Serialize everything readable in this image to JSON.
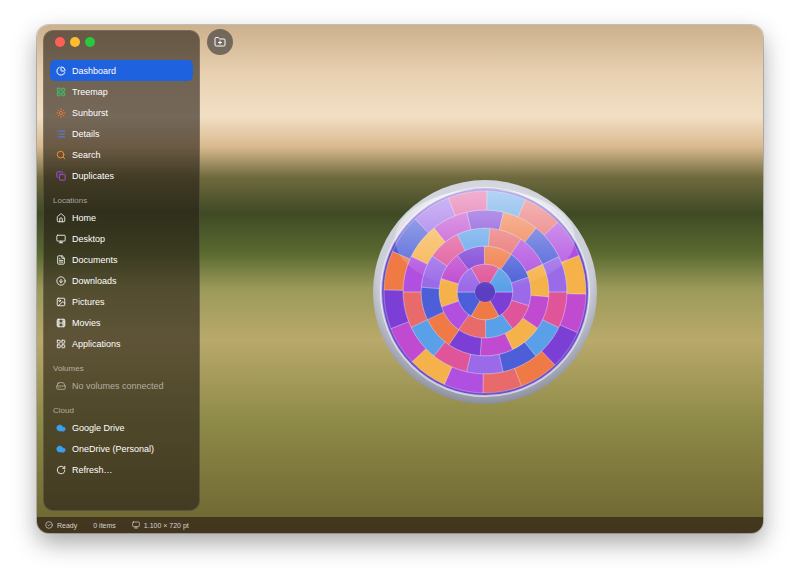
{
  "window": {
    "title": ""
  },
  "sidebar": {
    "nav": [
      {
        "label": "Dashboard",
        "selected": true,
        "color": "#e0409a"
      },
      {
        "label": "Treemap",
        "selected": false,
        "color": "#3cc46a"
      },
      {
        "label": "Sunburst",
        "selected": false,
        "color": "#f07a2a"
      },
      {
        "label": "Details",
        "selected": false,
        "color": "#5b7ff0"
      },
      {
        "label": "Search",
        "selected": false,
        "color": "#f0902a"
      },
      {
        "label": "Duplicates",
        "selected": false,
        "color": "#a04ee0"
      }
    ],
    "sections": [
      {
        "title": "Locations",
        "items": [
          {
            "label": "Home",
            "disabled": false,
            "kind": "place"
          },
          {
            "label": "Desktop",
            "disabled": false,
            "kind": "place"
          },
          {
            "label": "Documents",
            "disabled": false,
            "kind": "place"
          },
          {
            "label": "Downloads",
            "disabled": false,
            "kind": "place"
          },
          {
            "label": "Pictures",
            "disabled": false,
            "kind": "place"
          },
          {
            "label": "Movies",
            "disabled": false,
            "kind": "place"
          },
          {
            "label": "Applications",
            "disabled": false,
            "kind": "place"
          }
        ]
      },
      {
        "title": "Volumes",
        "items": [
          {
            "label": "No volumes connected",
            "disabled": true,
            "kind": "volume"
          }
        ]
      },
      {
        "title": "Cloud",
        "items": [
          {
            "label": "Google Drive",
            "disabled": false,
            "kind": "cloud"
          },
          {
            "label": "OneDrive (Personal)",
            "disabled": false,
            "kind": "cloud"
          },
          {
            "label": "Refresh…",
            "disabled": false,
            "kind": "action"
          }
        ]
      }
    ]
  },
  "status_bar": [
    {
      "text": "Ready"
    },
    {
      "text": "0 items"
    },
    {
      "text": "1.100 × 720 pt"
    }
  ]
}
